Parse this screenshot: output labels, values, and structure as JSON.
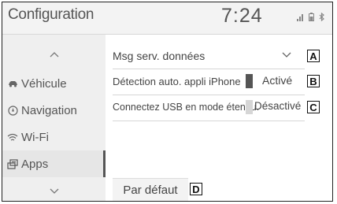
{
  "header": {
    "title": "Configuration",
    "clock": "7:24",
    "status_icons": "signal-icon battery-icon bluetooth-icon"
  },
  "sidebar": {
    "up_arrow": "^",
    "down_arrow": "⌄",
    "items": [
      {
        "label": "Véhicule",
        "icon": "car-icon",
        "glyph": "⛟"
      },
      {
        "label": "Navigation",
        "icon": "compass-icon",
        "glyph": "◍"
      },
      {
        "label": "Wi-Fi",
        "icon": "wifi-icon",
        "glyph": "≋"
      },
      {
        "label": "Apps",
        "icon": "apps-icon",
        "glyph": "▦",
        "selected": true
      }
    ]
  },
  "settings": {
    "rows": [
      {
        "label": "Msg serv. données",
        "marker": "A"
      },
      {
        "label": "Détection auto. appli iPhone",
        "status": "Activé",
        "marker": "B"
      },
      {
        "label": "Connectez USB en mode étendu.",
        "status": "Désactivé",
        "marker": "C"
      }
    ],
    "default_button": "Par défaut",
    "default_marker": "D"
  },
  "colors": {
    "toggle_on": "#555555",
    "toggle_off": "#d6d6d6"
  }
}
